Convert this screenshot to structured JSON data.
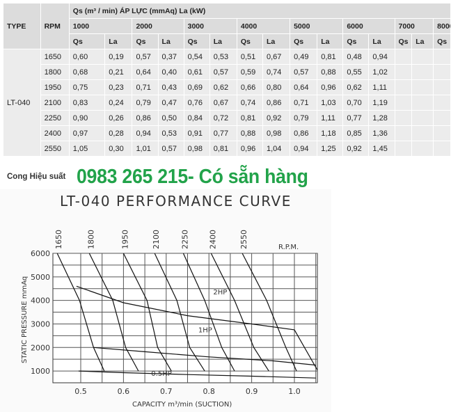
{
  "table": {
    "header_type": "TYPE",
    "header_rpm": "RPM",
    "header_main": "Qs (m³ / min) ÁP LỰC (mmAq) La (kW)",
    "pressure_levels": [
      "1000",
      "2000",
      "3000",
      "4000",
      "5000",
      "6000",
      "7000",
      "8000"
    ],
    "sub_qs": "Qs",
    "sub_la": "La",
    "type_value": "LT-040",
    "rows": [
      {
        "rpm": "1650",
        "cells": [
          "0,60",
          "0,19",
          "0,57",
          "0,37",
          "0,54",
          "0,53",
          "0,51",
          "0,67",
          "0,49",
          "0,81",
          "0,48",
          "0,94",
          "",
          "",
          "",
          ""
        ]
      },
      {
        "rpm": "1800",
        "cells": [
          "0,68",
          "0,21",
          "0,64",
          "0,40",
          "0,61",
          "0,57",
          "0,59",
          "0,74",
          "0,57",
          "0,88",
          "0,55",
          "1,02",
          "",
          "",
          "",
          ""
        ]
      },
      {
        "rpm": "1950",
        "cells": [
          "0,75",
          "0,23",
          "0,71",
          "0,43",
          "0,69",
          "0,62",
          "0,66",
          "0,80",
          "0,64",
          "0,96",
          "0,62",
          "1,11",
          "",
          "",
          "",
          ""
        ]
      },
      {
        "rpm": "2100",
        "cells": [
          "0,83",
          "0,24",
          "0,79",
          "0,47",
          "0,76",
          "0,67",
          "0,74",
          "0,86",
          "0,71",
          "1,03",
          "0,70",
          "1,19",
          "",
          "",
          "",
          ""
        ]
      },
      {
        "rpm": "2250",
        "cells": [
          "0,90",
          "0,26",
          "0,86",
          "0,50",
          "0,84",
          "0,72",
          "0,81",
          "0,92",
          "0,79",
          "1,11",
          "0,77",
          "1,28",
          "",
          "",
          "",
          ""
        ]
      },
      {
        "rpm": "2400",
        "cells": [
          "0,97",
          "0,28",
          "0,94",
          "0,53",
          "0,91",
          "0,77",
          "0,88",
          "0,98",
          "0,86",
          "1,18",
          "0,85",
          "1,36",
          "",
          "",
          "",
          ""
        ]
      },
      {
        "rpm": "2550",
        "cells": [
          "1,05",
          "0,30",
          "1,01",
          "0,57",
          "0,98",
          "0,81",
          "0,96",
          "1,04",
          "0,94",
          "1,25",
          "0,92",
          "1,45",
          "",
          "",
          "",
          ""
        ]
      }
    ]
  },
  "promo": {
    "label": "Cong Hiệu suất",
    "text": "0983 265 215- Có sẵn hàng"
  },
  "chart_data": {
    "type": "line",
    "title": "LT-040 PERFORMANCE CURVE",
    "xlabel": "CAPACITY m³/min (SUCTION)",
    "ylabel": "STATIC PRESSURE mmAq",
    "xlim": [
      0.45,
      1.06
    ],
    "ylim": [
      500,
      6000
    ],
    "x_ticks": [
      "0.5",
      "0.6",
      "0.7",
      "0.8",
      "0.9",
      "1.0"
    ],
    "y_ticks": [
      "6000",
      "5000",
      "4000",
      "3000",
      "2000",
      "1000"
    ],
    "rpm_label": "R.P.M.",
    "rpm_values": [
      "1650",
      "1800",
      "1950",
      "2100",
      "2250",
      "2400",
      "2550"
    ],
    "series": [
      {
        "name": "1650",
        "points": [
          [
            0.445,
            6000
          ],
          [
            0.497,
            4000
          ],
          [
            0.53,
            2000
          ],
          [
            0.555,
            1000
          ]
        ]
      },
      {
        "name": "1800",
        "points": [
          [
            0.52,
            6000
          ],
          [
            0.575,
            4000
          ],
          [
            0.605,
            2000
          ],
          [
            0.635,
            1000
          ]
        ]
      },
      {
        "name": "1950",
        "points": [
          [
            0.6,
            6000
          ],
          [
            0.655,
            4000
          ],
          [
            0.68,
            2000
          ],
          [
            0.712,
            1000
          ]
        ]
      },
      {
        "name": "2100",
        "points": [
          [
            0.673,
            6000
          ],
          [
            0.725,
            4000
          ],
          [
            0.755,
            2000
          ],
          [
            0.79,
            1000
          ]
        ]
      },
      {
        "name": "2250",
        "points": [
          [
            0.74,
            6000
          ],
          [
            0.79,
            4000
          ],
          [
            0.83,
            2000
          ],
          [
            0.86,
            1000
          ]
        ]
      },
      {
        "name": "2400",
        "points": [
          [
            0.805,
            6000
          ],
          [
            0.86,
            4000
          ],
          [
            0.905,
            2000
          ],
          [
            0.94,
            1000
          ]
        ]
      },
      {
        "name": "2550",
        "points": [
          [
            0.878,
            6000
          ],
          [
            0.935,
            4000
          ],
          [
            0.98,
            2000
          ],
          [
            1.005,
            1000
          ]
        ]
      },
      {
        "name": "2HP",
        "points": [
          [
            0.49,
            4600
          ],
          [
            0.6,
            3900
          ],
          [
            0.75,
            3350
          ],
          [
            0.9,
            3000
          ],
          [
            1.0,
            2750
          ],
          [
            1.055,
            1000
          ]
        ]
      },
      {
        "name": "1HP",
        "points": [
          [
            0.53,
            2000
          ],
          [
            0.65,
            1820
          ],
          [
            0.8,
            1600
          ],
          [
            0.95,
            1430
          ],
          [
            1.05,
            1250
          ]
        ]
      },
      {
        "name": "0.5HP",
        "points": [
          [
            0.495,
            1000
          ],
          [
            0.6,
            930
          ],
          [
            0.75,
            850
          ],
          [
            0.9,
            780
          ],
          [
            1.05,
            700
          ]
        ]
      }
    ],
    "annotations": [
      "2HP",
      "1HP",
      "0.5HP"
    ]
  }
}
